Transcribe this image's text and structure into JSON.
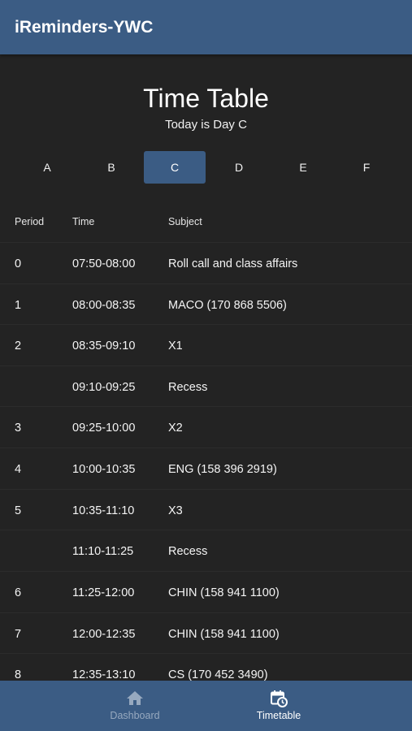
{
  "appbar": {
    "title": "iReminders-YWC"
  },
  "header": {
    "title": "Time Table",
    "subtitle": "Today is Day C"
  },
  "day_tabs": {
    "items": [
      "A",
      "B",
      "C",
      "D",
      "E",
      "F"
    ],
    "selected": "C"
  },
  "table": {
    "columns": [
      "Period",
      "Time",
      "Subject"
    ],
    "rows": [
      {
        "period": "0",
        "time": "07:50-08:00",
        "subject": "Roll call and class affairs"
      },
      {
        "period": "1",
        "time": "08:00-08:35",
        "subject": "MACO (170 868 5506)"
      },
      {
        "period": "2",
        "time": "08:35-09:10",
        "subject": "X1"
      },
      {
        "period": "",
        "time": "09:10-09:25",
        "subject": "Recess"
      },
      {
        "period": "3",
        "time": "09:25-10:00",
        "subject": "X2"
      },
      {
        "period": "4",
        "time": "10:00-10:35",
        "subject": "ENG (158 396 2919)"
      },
      {
        "period": "5",
        "time": "10:35-11:10",
        "subject": "X3"
      },
      {
        "period": "",
        "time": "11:10-11:25",
        "subject": "Recess"
      },
      {
        "period": "6",
        "time": "11:25-12:00",
        "subject": "CHIN (158 941 1100)"
      },
      {
        "period": "7",
        "time": "12:00-12:35",
        "subject": "CHIN (158 941 1100)"
      },
      {
        "period": "8",
        "time": "12:35-13:10",
        "subject": "CS (170 452 3490)"
      }
    ]
  },
  "bottom_nav": {
    "items": [
      {
        "label": "Dashboard",
        "icon": "home-icon",
        "active": false
      },
      {
        "label": "Timetable",
        "icon": "calendar-clock-icon",
        "active": true
      }
    ]
  },
  "colors": {
    "accent": "#3b5c84",
    "background": "#232323",
    "inactive_nav": "#97a9bf"
  }
}
